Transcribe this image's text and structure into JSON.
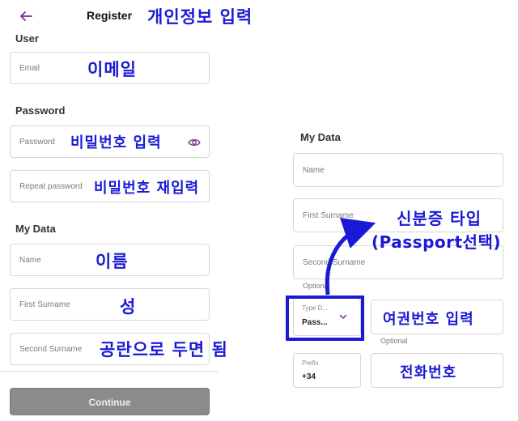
{
  "header": {
    "title": "Register",
    "annotation": "개인정보 입력"
  },
  "left": {
    "user_section": "User",
    "email": {
      "placeholder": "Email",
      "annotation": "이메일"
    },
    "password_section": "Password",
    "password": {
      "placeholder": "Password",
      "annotation": "비밀번호 입력"
    },
    "repeat_password": {
      "placeholder": "Repeat password",
      "annotation": "비밀번호 재입력"
    },
    "mydata_section": "My Data",
    "name": {
      "placeholder": "Name",
      "annotation": "이름"
    },
    "first_surname": {
      "placeholder": "First Surname",
      "annotation": "성"
    },
    "second_surname": {
      "placeholder": "Second Surname",
      "annotation": "공란으로 두면 됨"
    },
    "continue_label": "Continue"
  },
  "right": {
    "mydata_section": "My Data",
    "name": {
      "placeholder": "Name"
    },
    "first_surname": {
      "placeholder": "First Surname"
    },
    "second_surname": {
      "placeholder": "Second Surname",
      "helper": "Optional"
    },
    "doc_type": {
      "caption": "Type D...",
      "value": "Pass...",
      "annotation_line1": "신분증 타입",
      "annotation_line2": "(Passport선택)"
    },
    "doc_number": {
      "annotation": "여권번호 입력",
      "helper": "Optional"
    },
    "prefix": {
      "caption": "Prefix",
      "value": "+34"
    },
    "phone": {
      "annotation": "전화번호"
    }
  },
  "colors": {
    "accent": "#7b2a8c",
    "annotation": "#1a1ad6",
    "button_disabled": "#8b8b8b"
  },
  "icons": {
    "back": "arrow-left-icon",
    "eye": "eye-icon",
    "chevron": "chevron-down-icon"
  }
}
